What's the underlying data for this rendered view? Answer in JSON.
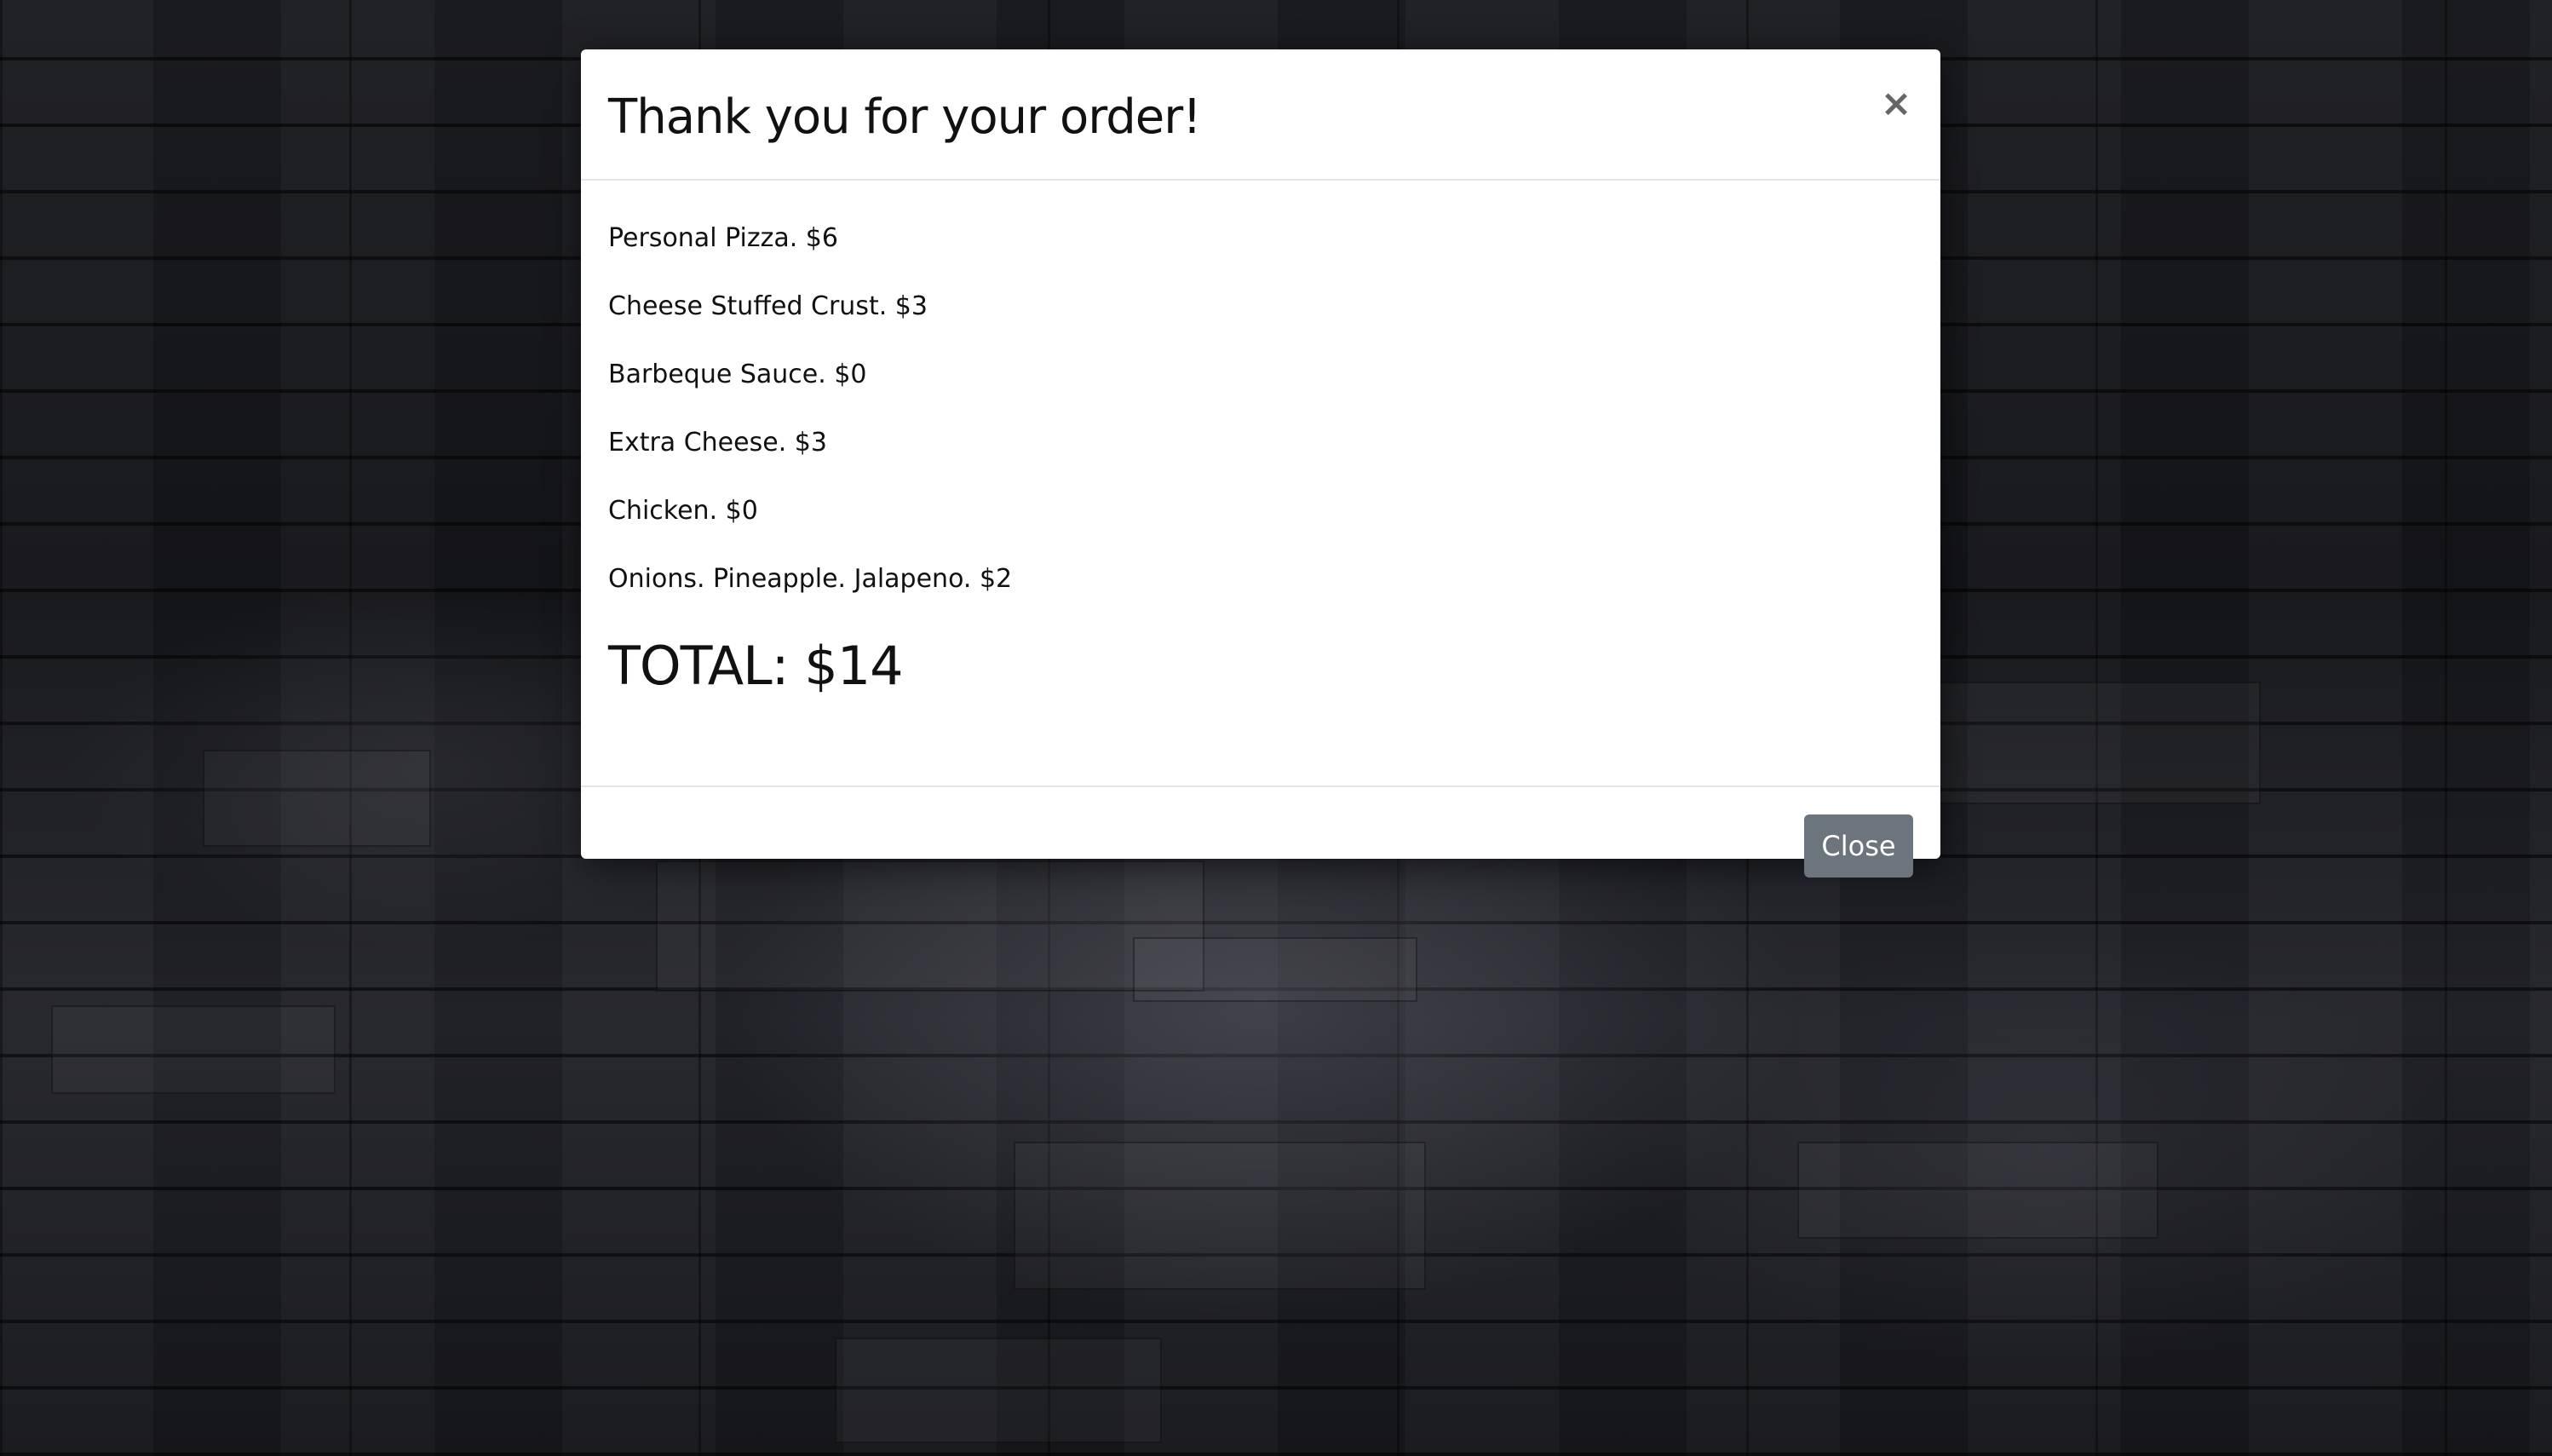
{
  "modal": {
    "title": "Thank you for your order!",
    "close_icon": "×",
    "items": [
      "Personal Pizza. $6",
      "Cheese Stuffed Crust. $3",
      "Barbeque Sauce. $0",
      "Extra Cheese. $3",
      "Chicken. $0",
      "Onions. Pineapple. Jalapeno. $2"
    ],
    "total": "TOTAL: $14",
    "close_button_label": "Close"
  },
  "colors": {
    "button_bg": "#6c757d",
    "modal_bg": "#ffffff",
    "backdrop": "#15161a"
  },
  "icons": {
    "close": "close-icon"
  }
}
